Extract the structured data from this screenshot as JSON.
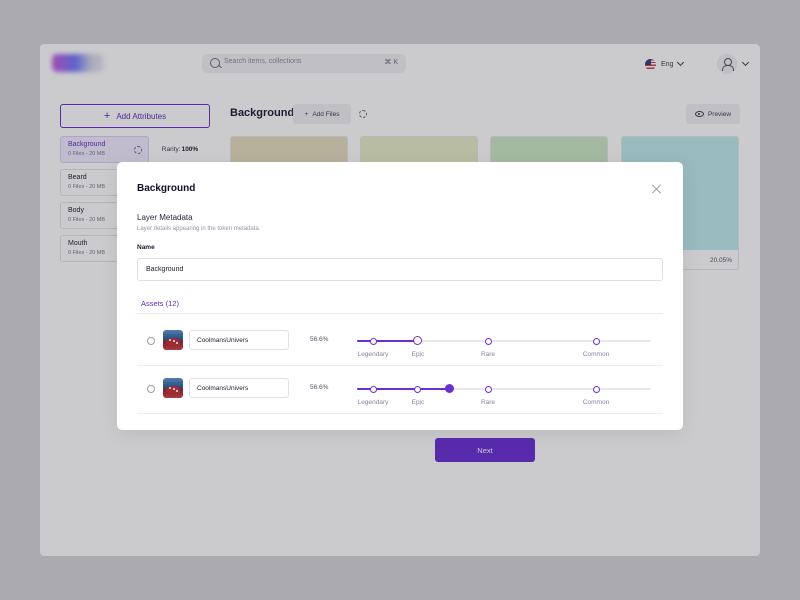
{
  "header": {
    "search_placeholder": "Search items, collections",
    "search_shortcut": "⌘ K",
    "language": "Eng"
  },
  "sidebar": {
    "add_attributes_label": "Add Attributes",
    "rarity_prefix": "Rarity:",
    "rarity_value": "100%",
    "items": [
      {
        "name": "Background",
        "meta": "0 Files - 20 MB"
      },
      {
        "name": "Beard",
        "meta": "0 Files - 20 MB"
      },
      {
        "name": "Body",
        "meta": "0 Files - 20 MB"
      },
      {
        "name": "Mouth",
        "meta": "0 Files - 20 MB"
      }
    ]
  },
  "main": {
    "title": "Background",
    "add_files_label": "Add Files",
    "preview_label": "Preview",
    "cards": [
      {
        "color": "#e6dec0"
      },
      {
        "color": "#e7edc6"
      },
      {
        "color": "#cce9c6"
      },
      {
        "color": "#bdeaea",
        "percent": "20.05%"
      }
    ],
    "next_label": "Next"
  },
  "modal": {
    "title": "Background",
    "section_title": "Layer Metadata",
    "section_desc": "Layer details appearing in the token metadata.",
    "name_label": "Name",
    "name_value": "Background",
    "tab_label": "Assets (12)",
    "rarity_levels": [
      "Legendary",
      "Epic",
      "Rare",
      "Common"
    ],
    "assets": [
      {
        "name": "CoolmansUnivers",
        "percent": "56.6%"
      },
      {
        "name": "CoolmansUnivers",
        "percent": "56.6%"
      }
    ]
  },
  "colors": {
    "accent": "#6a2fd6",
    "overlay": "rgba(30,30,40,0.23)"
  }
}
